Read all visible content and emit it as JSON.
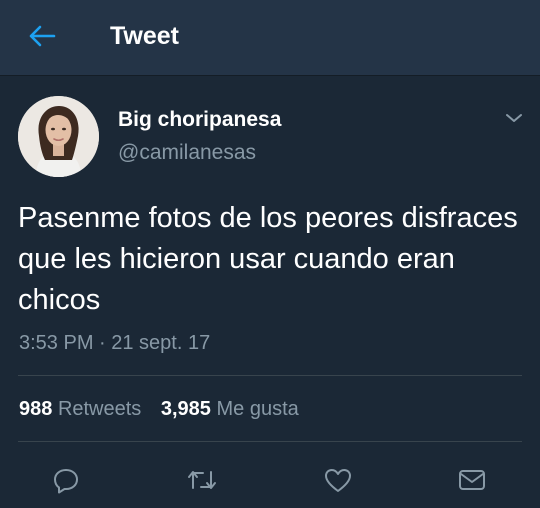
{
  "header": {
    "title": "Tweet",
    "back_icon": "arrow-left-icon"
  },
  "tweet": {
    "author": {
      "display_name": "Big choripanesa",
      "handle": "@camilanesas"
    },
    "text": "Pasenme fotos de los peores disfraces que les hicieron usar cuando eran chicos",
    "timestamp": "3:53 PM · 21 sept. 17",
    "stats": {
      "retweets_count": "988",
      "retweets_label": "Retweets",
      "likes_count": "3,985",
      "likes_label": "Me gusta"
    },
    "actions": [
      "reply-icon",
      "retweet-icon",
      "like-icon",
      "direct-message-icon"
    ]
  },
  "colors": {
    "background": "#1b2836",
    "header": "#243447",
    "accent": "#1da1f2",
    "secondary_text": "#8899a6",
    "divider": "#38444d"
  }
}
